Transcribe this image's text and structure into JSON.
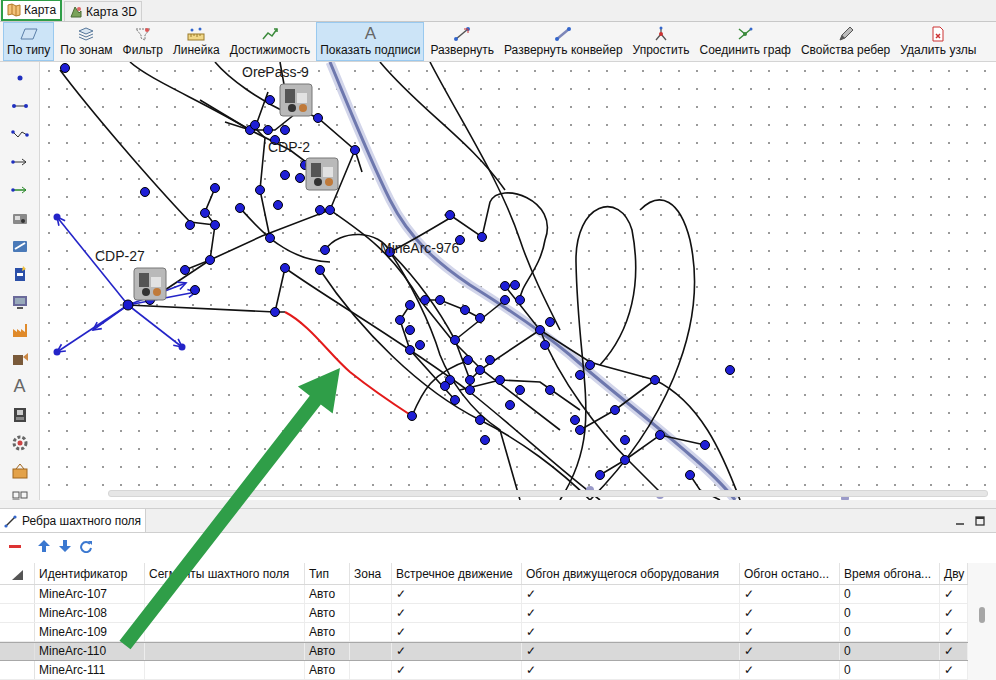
{
  "tabs": [
    {
      "label": "Карта",
      "selected": true
    },
    {
      "label": "Карта 3D",
      "selected": false
    }
  ],
  "toolbar": [
    {
      "label": "По типу",
      "selected": true
    },
    {
      "label": "По зонам",
      "selected": false
    },
    {
      "label": "Фильтр",
      "selected": false
    },
    {
      "label": "Линейка",
      "selected": false
    },
    {
      "label": "Достижимость",
      "selected": false
    },
    {
      "label": "Показать подписи",
      "selected": true,
      "glyph": "A"
    },
    {
      "label": "Развернуть",
      "selected": false
    },
    {
      "label": "Развернуть конвейер",
      "selected": false
    },
    {
      "label": "Упростить",
      "selected": false
    },
    {
      "label": "Соединить граф",
      "selected": false
    },
    {
      "label": "Свойства ребер",
      "selected": false
    },
    {
      "label": "Удалить узлы",
      "selected": false
    }
  ],
  "left_toolbar": {
    "glyph": "A"
  },
  "map": {
    "labels": [
      "OrePass-9",
      "CDP-2",
      "CDP-27",
      "MineArc-976"
    ],
    "highlighted_edge": {
      "selected": true,
      "color": "#e31a1a"
    }
  },
  "panel": {
    "title": "Ребра шахтного поля"
  },
  "table": {
    "columns": [
      "Идентификатор",
      "Сегменты шахтного поля",
      "Тип",
      "Зона",
      "Встречное движение",
      "Обгон движущегося оборудования",
      "Обгон остано...",
      "Время обгона...",
      "Дву"
    ],
    "rows": [
      {
        "id": "MineArc-107",
        "type": "Авто",
        "oncoming": "✓",
        "overtake_moving": "✓",
        "overtake_stopped": "✓",
        "overtake_time": "0",
        "bidirectional": "✓",
        "selected": false
      },
      {
        "id": "MineArc-108",
        "type": "Авто",
        "oncoming": "✓",
        "overtake_moving": "✓",
        "overtake_stopped": "✓",
        "overtake_time": "0",
        "bidirectional": "✓",
        "selected": false
      },
      {
        "id": "MineArc-109",
        "type": "Авто",
        "oncoming": "✓",
        "overtake_moving": "✓",
        "overtake_stopped": "✓",
        "overtake_time": "0",
        "bidirectional": "✓",
        "selected": false
      },
      {
        "id": "MineArc-110",
        "type": "Авто",
        "oncoming": "✓",
        "overtake_moving": "✓",
        "overtake_stopped": "✓",
        "overtake_time": "0",
        "bidirectional": "✓",
        "selected": true
      },
      {
        "id": "MineArc-111",
        "type": "Авто",
        "oncoming": "✓",
        "overtake_moving": "✓",
        "overtake_stopped": "✓",
        "overtake_time": "0",
        "bidirectional": "✓",
        "selected": false
      }
    ]
  }
}
